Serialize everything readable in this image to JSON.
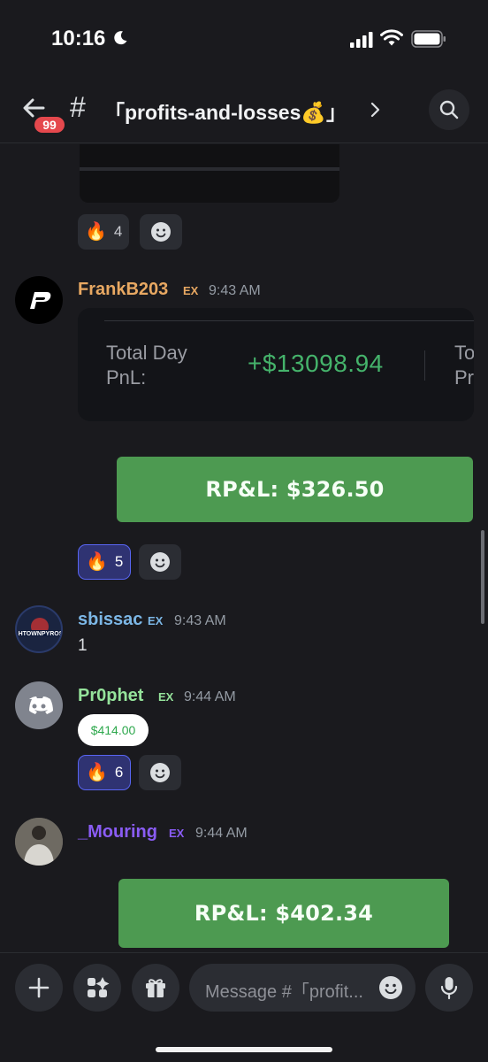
{
  "status_bar": {
    "time": "10:16"
  },
  "header": {
    "unread_badge": "99",
    "channel_hash": "#",
    "channel_name": "「profits-and-losses💰」"
  },
  "messages": [
    {
      "reactions": [
        {
          "emoji": "🔥",
          "count": "4"
        }
      ]
    },
    {
      "username": "FrankB203",
      "username_color": "#e8a862",
      "timestamp": "9:43 AM",
      "pnl_card": {
        "label": "Total Day PnL:",
        "value": "+$13098.94",
        "cut_label": "To Pr"
      },
      "button_label": "RP&L: $326.50",
      "reactions": [
        {
          "emoji": "🔥",
          "count": "5"
        }
      ]
    },
    {
      "username": "sbissac",
      "username_color": "#7cb7e6",
      "timestamp": "9:43 AM",
      "text": "1"
    },
    {
      "username": "Pr0phet",
      "username_color": "#95e39b",
      "timestamp": "9:44 AM",
      "amount": "$414.00",
      "reactions": [
        {
          "emoji": "🔥",
          "count": "6"
        }
      ]
    },
    {
      "username": "_Mouring",
      "username_color": "#8a5cf5",
      "timestamp": "9:44 AM",
      "button_label": "RP&L: $402.34"
    }
  ],
  "composer": {
    "placeholder": "Message #「profit..."
  },
  "colors": {
    "accent": "#5865f2",
    "profit_green": "#45b36b",
    "button_green": "#4d9a51",
    "badge_red": "#e5484d"
  }
}
